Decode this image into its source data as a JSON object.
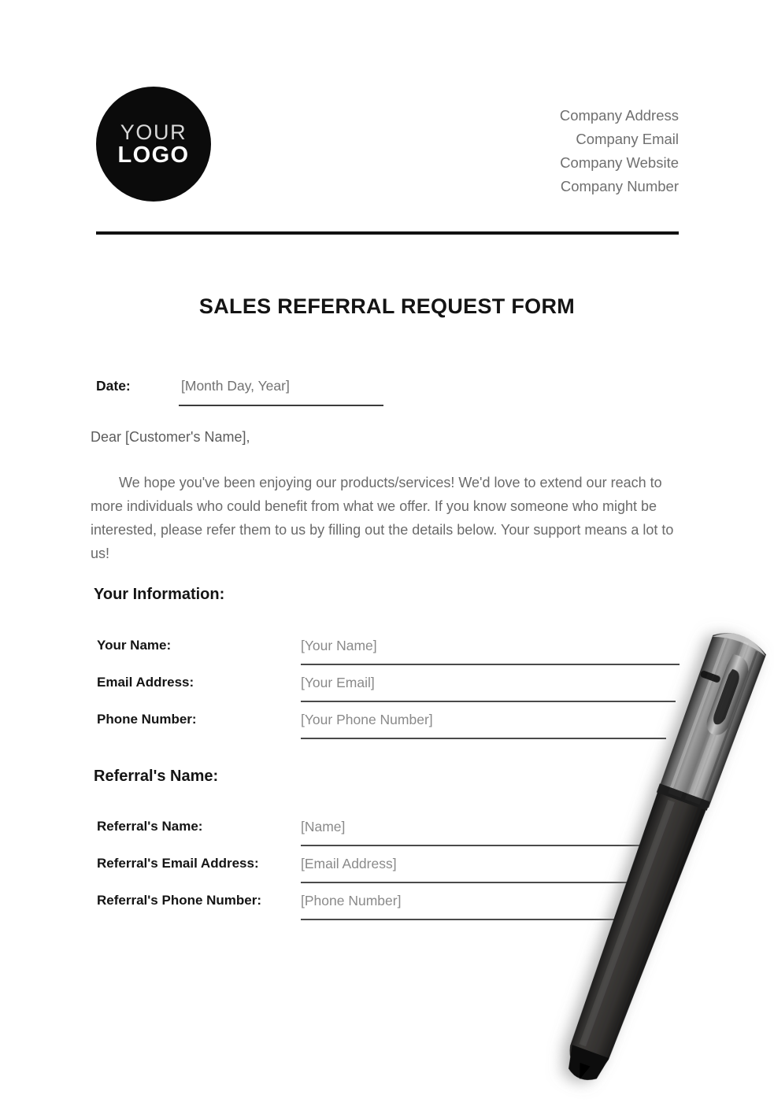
{
  "document": {
    "title": "SALES REFERRAL REQUEST FORM"
  },
  "header": {
    "logo": {
      "line1": "YOUR",
      "line2": "LOGO"
    },
    "company_info": [
      "Company Address",
      "Company Email",
      "Company Website",
      "Company Number"
    ]
  },
  "date_row": {
    "label": "Date:",
    "value": "[Month Day, Year]"
  },
  "letter": {
    "salutation": "Dear [Customer's Name],",
    "paragraph": "We hope you've been enjoying our products/services! We'd love to extend our reach to more individuals who could benefit from what we offer. If you know someone who might be interested, please refer them to us by filling out the details below. Your support means a lot to us!"
  },
  "sections": [
    {
      "heading": "Your Information:",
      "fields": [
        {
          "label": "Your Name:",
          "value": "[Your Name]"
        },
        {
          "label": "Email Address:",
          "value": "[Your Email]"
        },
        {
          "label": "Phone Number:",
          "value": "[Your Phone Number]"
        }
      ]
    },
    {
      "heading": "Referral's Name:",
      "fields": [
        {
          "label": "Referral's Name:",
          "value": "[Name]"
        },
        {
          "label": "Referral's Email Address:",
          "value": "[Email Address]"
        },
        {
          "label": "Referral's Phone Number:",
          "value": "[Phone Number]"
        }
      ]
    }
  ],
  "decoration": {
    "pen_image": "ballpoint-pen-photo"
  },
  "colors": {
    "logo_background": "#0b0b0b",
    "rule": "#111111",
    "heading_text": "#141414",
    "body_text": "#6a6a6a",
    "placeholder_text": "#8a8a8a",
    "field_line": "#4a4a4a",
    "page_background": "#ffffff"
  }
}
